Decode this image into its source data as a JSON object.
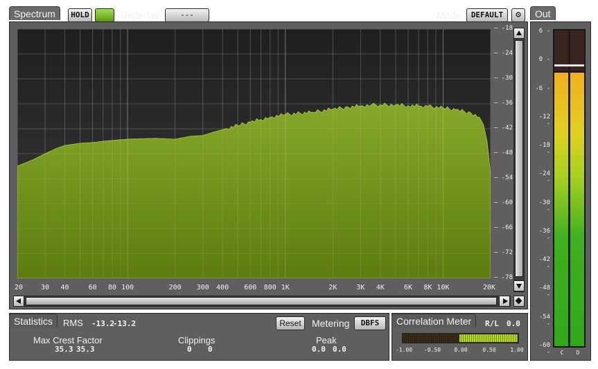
{
  "spectrum": {
    "tab_label": "Spectrum",
    "hold_label": "HOLD",
    "underlay_label": "Underlay",
    "underlay_value": "---",
    "mode_label": "Mode",
    "mode_value": "DEFAULT",
    "settings_icon": "gear-icon",
    "colors": {
      "fill": "#6e8d18",
      "fill_top": "#86a82a",
      "background": "#2b2b2b",
      "hold_led": "#78c21a"
    },
    "y_ticks": [
      "-18",
      "-24",
      "-30",
      "-36",
      "-42",
      "-48",
      "-54",
      "-60",
      "-66",
      "-72",
      "-78"
    ],
    "x_ticks": [
      "20",
      "30",
      "40",
      "60",
      "80",
      "100",
      "200",
      "300",
      "400",
      "600",
      "800",
      "1K",
      "2K",
      "3K",
      "4K",
      "6K",
      "8K",
      "10K",
      "20K"
    ]
  },
  "chart_data": {
    "type": "area",
    "x_scale": "log",
    "xlim": [
      20,
      20000
    ],
    "ylim": [
      -78,
      -18
    ],
    "x": [
      20,
      25,
      30,
      35,
      40,
      50,
      60,
      70,
      80,
      100,
      150,
      200,
      250,
      300,
      350,
      400,
      500,
      600,
      700,
      800,
      1000,
      1500,
      2000,
      2500,
      3000,
      3500,
      4000,
      5000,
      6000,
      7000,
      8000,
      10000,
      12000,
      15000,
      17000,
      18000,
      19000,
      20000
    ],
    "values": [
      -51,
      -49.5,
      -48,
      -46.8,
      -46,
      -45.5,
      -45.3,
      -45,
      -44.8,
      -44.5,
      -44.3,
      -44.5,
      -43.8,
      -43.6,
      -42.8,
      -42.2,
      -41.2,
      -40.4,
      -39.8,
      -39.2,
      -38.6,
      -38,
      -37.3,
      -36.8,
      -36.5,
      -36.3,
      -36.2,
      -36.3,
      -36.4,
      -36.5,
      -36.6,
      -37,
      -37.4,
      -38.2,
      -39.2,
      -41,
      -45,
      -53
    ]
  },
  "statistics": {
    "tab_label": "Statistics",
    "rms_label": "RMS",
    "rms_values": [
      "-13.2",
      "-13.2"
    ],
    "reset_label": "Reset",
    "metering_label": "Metering",
    "metering_value": "DBFS",
    "max_crest_label": "Max Crest Factor",
    "max_crest_values": [
      "35.3",
      "35.3"
    ],
    "clippings_label": "Clippings",
    "clippings_values": [
      "0",
      "0"
    ],
    "peak_label": "Peak",
    "peak_values": [
      "0.0",
      "0.0"
    ]
  },
  "correlation": {
    "tab_label": "Correlation Meter",
    "rl_label": "R/L",
    "rl_value": "0.0",
    "ticks": [
      "-1.00",
      "-0.50",
      "0.00",
      "0.50",
      "1.00"
    ]
  },
  "out": {
    "tab_label": "Out",
    "ticks": [
      "6",
      "0",
      "-6",
      "-12",
      "-18",
      "-24",
      "-30",
      "-36",
      "-42",
      "-48",
      "-54",
      "-60"
    ],
    "channels": [
      "C",
      "D"
    ],
    "level_db": -3.2,
    "peak_db": -1
  }
}
